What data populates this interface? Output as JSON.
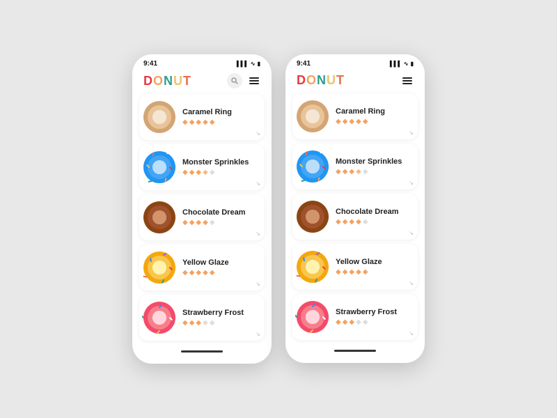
{
  "phones": [
    {
      "id": "phone-left",
      "status": {
        "time": "9:41",
        "signal": "▌▌▌",
        "wifi": "WiFi",
        "battery": "▮"
      },
      "header": {
        "logo": "DONUT",
        "search_visible": true,
        "menu_label": "menu"
      },
      "donuts": [
        {
          "name": "Caramel Ring",
          "stars": 5,
          "half": false,
          "color": "#c8956c",
          "ring": "#e8b97e",
          "glaze": "#d4a574",
          "sprinkle": false,
          "emoji": "caramel"
        },
        {
          "name": "Monster Sprinkles",
          "stars": 3,
          "half": true,
          "color": "#3a86ff",
          "ring": "#2196f3",
          "glaze": "#1a6cc7",
          "sprinkle": true,
          "emoji": "sprinkles"
        },
        {
          "name": "Chocolate Dream",
          "stars": 4,
          "half": false,
          "color": "#8B4513",
          "ring": "#a0522d",
          "glaze": "#6b3410",
          "sprinkle": false,
          "emoji": "chocolate"
        },
        {
          "name": "Yellow Glaze",
          "stars": 5,
          "half": false,
          "color": "#f9c74f",
          "ring": "#f4a80e",
          "glaze": "#e8960a",
          "sprinkle": true,
          "emoji": "yellow"
        },
        {
          "name": "Strawberry Frost",
          "stars": 3,
          "half": false,
          "color": "#f77f8c",
          "ring": "#f44b6a",
          "glaze": "#e8304d",
          "sprinkle": true,
          "emoji": "strawberry"
        }
      ]
    },
    {
      "id": "phone-right",
      "status": {
        "time": "9:41",
        "signal": "▌▌▌",
        "wifi": "WiFi",
        "battery": "▮"
      },
      "header": {
        "logo": "DONUT",
        "search_visible": false,
        "menu_label": "menu"
      },
      "donuts": [
        {
          "name": "Caramel Ring",
          "stars": 5,
          "half": false,
          "color": "#c8956c",
          "emoji": "caramel"
        },
        {
          "name": "Monster Sprinkles",
          "stars": 3,
          "half": true,
          "color": "#3a86ff",
          "emoji": "sprinkles"
        },
        {
          "name": "Chocolate Dream",
          "stars": 4,
          "half": false,
          "color": "#8B4513",
          "emoji": "chocolate"
        },
        {
          "name": "Yellow Glaze",
          "stars": 5,
          "half": false,
          "color": "#f9c74f",
          "emoji": "yellow"
        },
        {
          "name": "Strawberry Frost",
          "stars": 3,
          "half": false,
          "color": "#f77f8c",
          "emoji": "strawberry"
        }
      ]
    }
  ],
  "logo_letters": [
    {
      "char": "D",
      "color": "#e63946"
    },
    {
      "char": "O",
      "color": "#f4a261"
    },
    {
      "char": "N",
      "color": "#2a9d8f"
    },
    {
      "char": "U",
      "color": "#e9c46a"
    },
    {
      "char": "T",
      "color": "#e76f51"
    }
  ]
}
